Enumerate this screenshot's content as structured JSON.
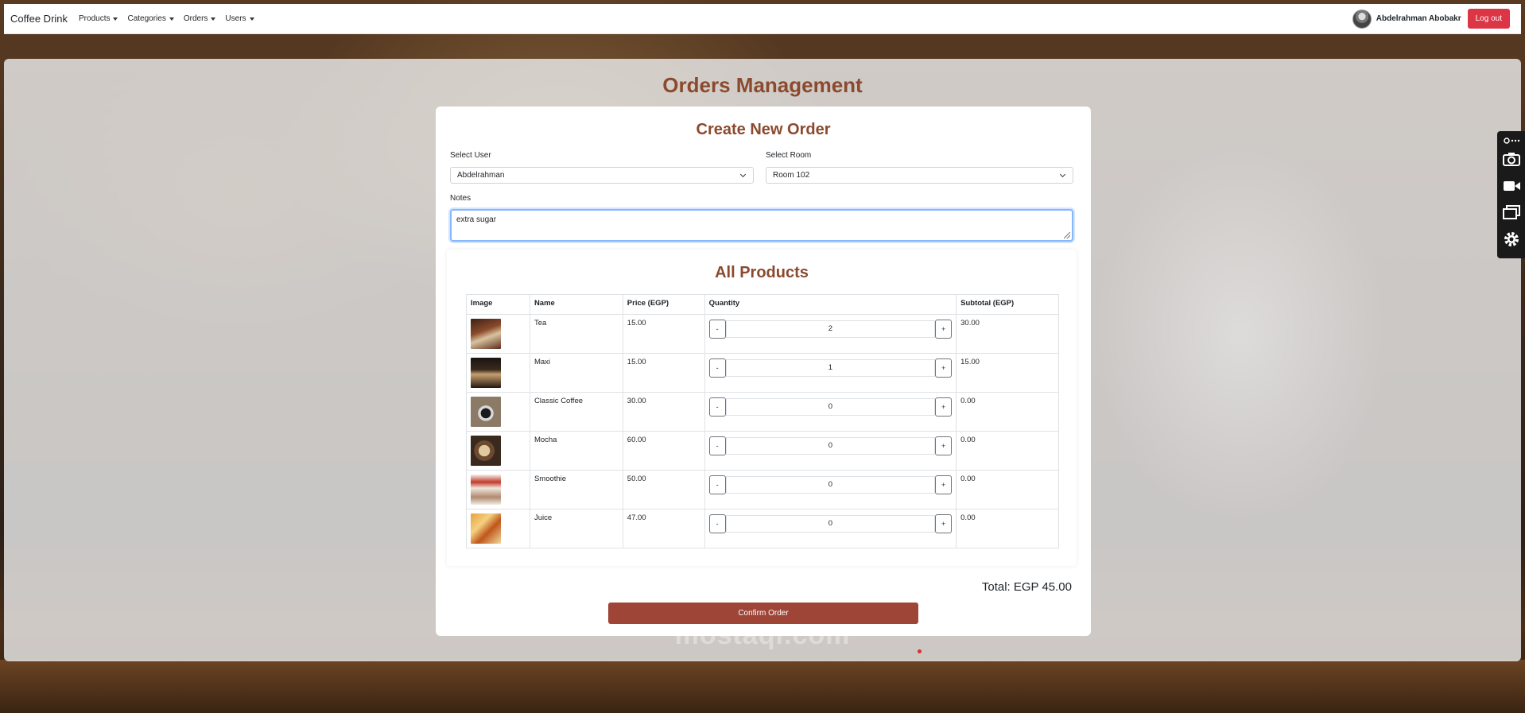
{
  "navbar": {
    "brand": "Coffee Drink",
    "menus": [
      "Products",
      "Categories",
      "Orders",
      "Users"
    ],
    "user_name": "Abdelrahman Abobakr",
    "logout_label": "Log out"
  },
  "page": {
    "title": "Orders Management"
  },
  "order_form": {
    "title": "Create New Order",
    "user_label": "Select User",
    "user_value": "Abdelrahman",
    "room_label": "Select Room",
    "room_value": "Room 102",
    "notes_label": "Notes",
    "notes_value": "extra sugar"
  },
  "products": {
    "title": "All Products",
    "columns": [
      "Image",
      "Name",
      "Price (EGP)",
      "Quantity",
      "Subtotal (EGP)"
    ],
    "rows": [
      {
        "name": "Tea",
        "price": "15.00",
        "quantity": "2",
        "subtotal": "30.00",
        "image": "tea-image"
      },
      {
        "name": "Maxi",
        "price": "15.00",
        "quantity": "1",
        "subtotal": "15.00",
        "image": "maxi-image"
      },
      {
        "name": "Classic Coffee",
        "price": "30.00",
        "quantity": "0",
        "subtotal": "0.00",
        "image": "classic-coffee-image"
      },
      {
        "name": "Mocha",
        "price": "60.00",
        "quantity": "0",
        "subtotal": "0.00",
        "image": "mocha-image"
      },
      {
        "name": "Smoothie",
        "price": "50.00",
        "quantity": "0",
        "subtotal": "0.00",
        "image": "smoothie-image"
      },
      {
        "name": "Juice",
        "price": "47.00",
        "quantity": "0",
        "subtotal": "0.00",
        "image": "juice-image"
      }
    ],
    "minus_label": "-",
    "plus_label": "+"
  },
  "summary": {
    "total": "Total: EGP 45.00",
    "confirm_label": "Confirm Order"
  },
  "watermark": "mostaql.com",
  "colors": {
    "accent": "#8b4a2e",
    "confirm": "#9e4538",
    "logout": "#dc3545"
  }
}
